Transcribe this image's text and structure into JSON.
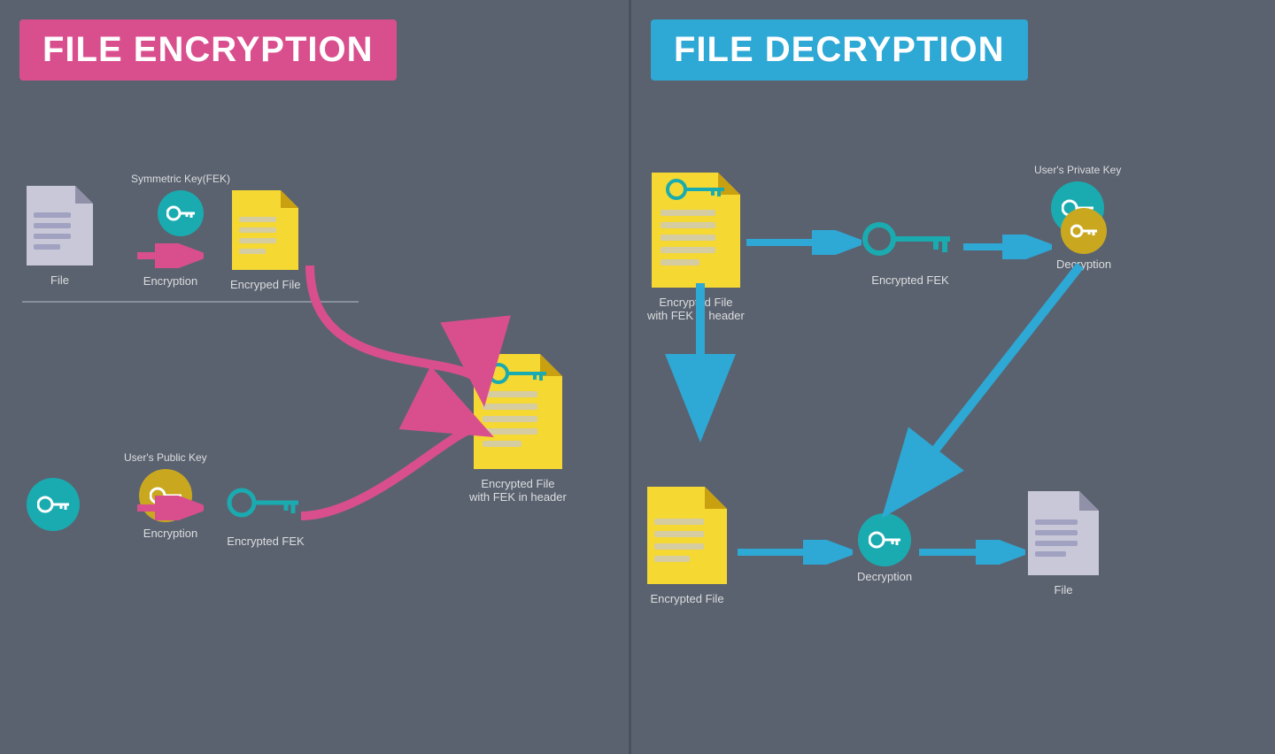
{
  "left_title": "FILE ENCRYPTION",
  "right_title": "FILE DECRYPTION",
  "enc": {
    "file_label": "File",
    "sym_key_label": "Symmetric Key(FEK)",
    "encryption_label_top": "Encryption",
    "encryped_file_label": "Encryped File",
    "public_key_label": "User's Public Key",
    "encryption_label_bottom": "Encryption",
    "encrypted_fek_label": "Encrypted FEK",
    "encrypted_file_header_label": "Encrypted File\nwith FEK in header"
  },
  "dec": {
    "encrypted_file_header_label": "Encrypted File\nwith FEK in header",
    "encrypted_fek_label": "Encrypted FEK",
    "private_key_label": "User's Private Key",
    "decryption_label_top": "Decryption",
    "encrypted_file_label": "Encrypted File",
    "decryption_label_bottom": "Decryption",
    "file_label": "File"
  },
  "colors": {
    "bg": "#5a6270",
    "enc_title": "#d94f8e",
    "dec_title": "#2ea8d4",
    "teal": "#1aabb0",
    "gold": "#c9a820",
    "yellow": "#f5d832",
    "pink_arrow": "#d94f8e",
    "blue_arrow": "#2ea8d4",
    "grey_doc": "#c8c8d8"
  }
}
